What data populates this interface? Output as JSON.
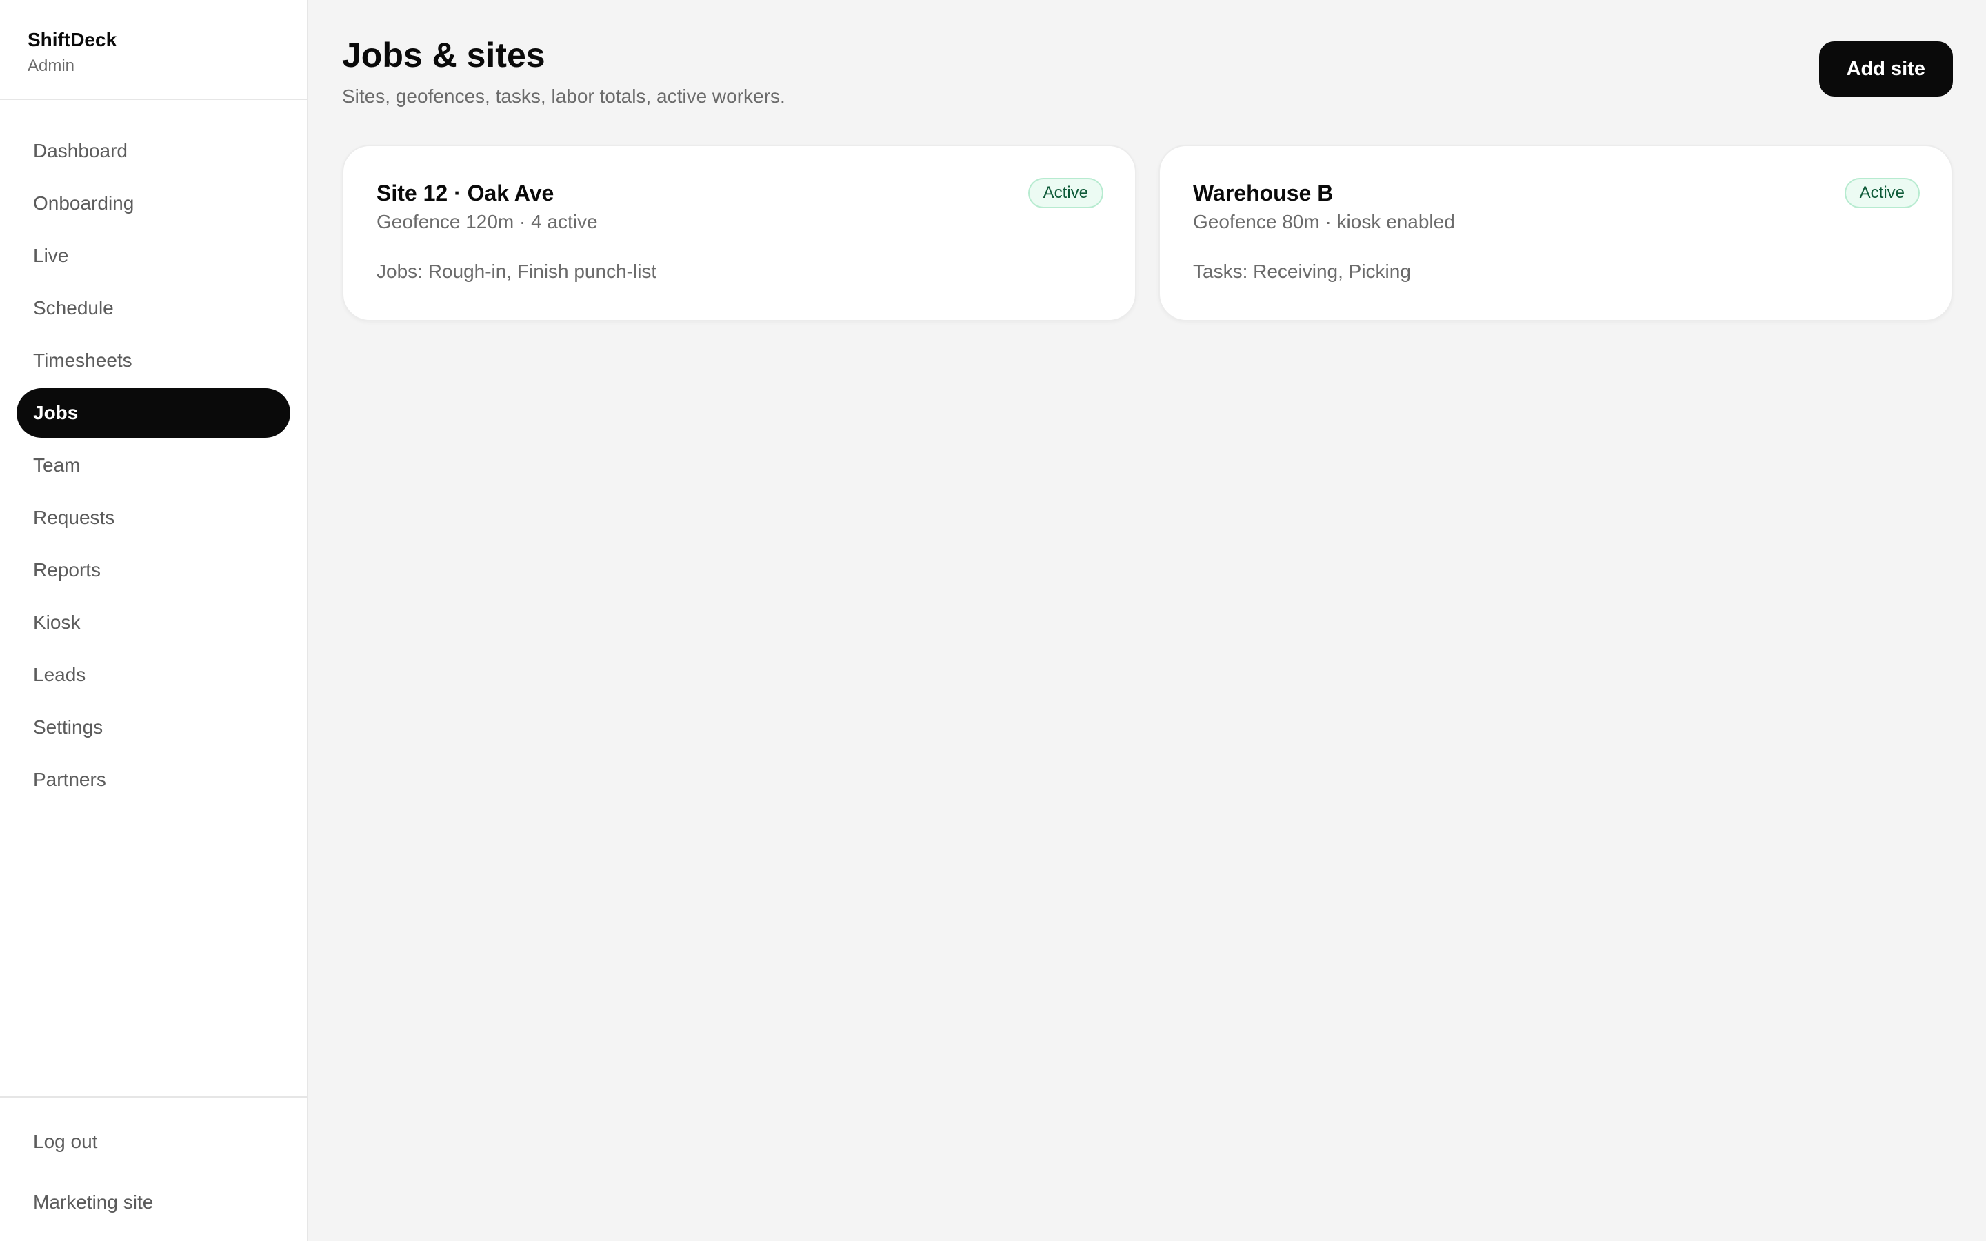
{
  "brand": {
    "name": "ShiftDeck",
    "role": "Admin"
  },
  "nav": {
    "items": [
      {
        "label": "Dashboard"
      },
      {
        "label": "Onboarding"
      },
      {
        "label": "Live"
      },
      {
        "label": "Schedule"
      },
      {
        "label": "Timesheets"
      },
      {
        "label": "Jobs",
        "active": true
      },
      {
        "label": "Team"
      },
      {
        "label": "Requests"
      },
      {
        "label": "Reports"
      },
      {
        "label": "Kiosk"
      },
      {
        "label": "Leads"
      },
      {
        "label": "Settings"
      },
      {
        "label": "Partners"
      }
    ]
  },
  "footer": {
    "logout": "Log out",
    "marketing": "Marketing site"
  },
  "header": {
    "title": "Jobs & sites",
    "subtitle": "Sites, geofences, tasks, labor totals, active workers.",
    "add_button": "Add site"
  },
  "sites": [
    {
      "name": "Site 12 · Oak Ave",
      "meta": "Geofence 120m · 4 active",
      "detail": "Jobs: Rough-in, Finish punch-list",
      "status": "Active"
    },
    {
      "name": "Warehouse B",
      "meta": "Geofence 80m · kiosk enabled",
      "detail": "Tasks: Receiving, Picking",
      "status": "Active"
    }
  ],
  "colors": {
    "accent": "#0a0a0a",
    "badge_bg": "#ecfbf3",
    "badge_border": "#b7ebd0",
    "badge_text": "#0e5a38"
  }
}
